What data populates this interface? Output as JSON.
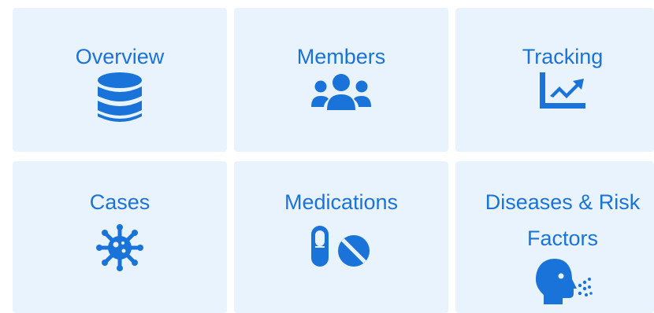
{
  "accent_color": "#1a73d9",
  "tile_background": "#e9f3fd",
  "tiles": [
    {
      "label": "Overview",
      "icon": "database-icon"
    },
    {
      "label": "Members",
      "icon": "users-icon"
    },
    {
      "label": "Tracking",
      "icon": "chart-line-icon"
    },
    {
      "label": "Cases",
      "icon": "virus-icon"
    },
    {
      "label": "Medications",
      "icon": "pills-icon"
    },
    {
      "label": "Diseases & Risk Factors",
      "label_line1": "Diseases & Risk",
      "label_line2": "Factors",
      "icon": "head-side-cough-icon"
    }
  ]
}
